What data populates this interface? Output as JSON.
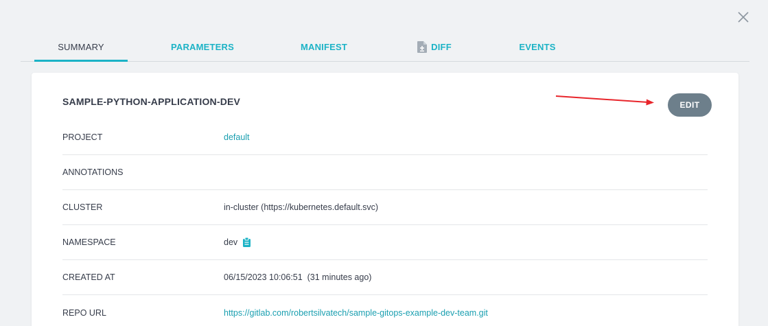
{
  "close": {
    "icon": "close-icon"
  },
  "tabs": [
    {
      "label": "SUMMARY",
      "active": true
    },
    {
      "label": "PARAMETERS",
      "active": false
    },
    {
      "label": "MANIFEST",
      "active": false
    },
    {
      "label": "DIFF",
      "active": false,
      "icon": "file-diff-icon"
    },
    {
      "label": "EVENTS",
      "active": false
    }
  ],
  "summary": {
    "app_name": "SAMPLE-PYTHON-APPLICATION-DEV",
    "edit_label": "EDIT",
    "rows": [
      {
        "label": "PROJECT",
        "value": "default"
      },
      {
        "label": "ANNOTATIONS",
        "value": ""
      },
      {
        "label": "CLUSTER",
        "value": "in-cluster (https://kubernetes.default.svc)"
      },
      {
        "label": "NAMESPACE",
        "value": "dev",
        "icon": "clipboard-icon"
      },
      {
        "label": "CREATED AT",
        "value": "06/15/2023 10:06:51  (31 minutes ago)"
      },
      {
        "label": "REPO URL",
        "value": "https://gitlab.com/robertsilvatech/sample-gitops-example-dev-team.git"
      }
    ]
  },
  "colors": {
    "accent": "#1cb3c6",
    "link": "#1a9fb0",
    "edit_button": "#6d7f8b",
    "annotation_arrow": "#e8252b"
  }
}
